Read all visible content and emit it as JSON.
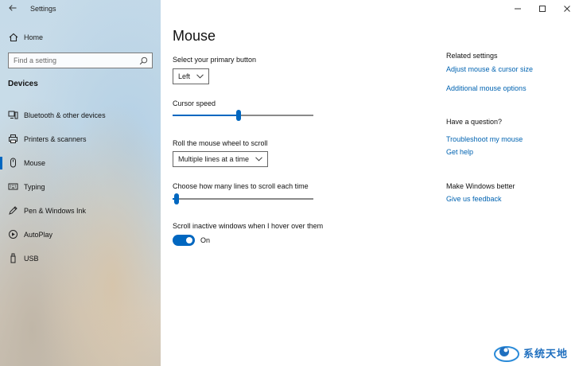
{
  "window": {
    "title": "Settings"
  },
  "sidebar": {
    "home_label": "Home",
    "search_placeholder": "Find a setting",
    "group_label": "Devices",
    "items": [
      {
        "label": "Bluetooth & other devices",
        "icon": "bluetooth-devices-icon"
      },
      {
        "label": "Printers & scanners",
        "icon": "printer-icon"
      },
      {
        "label": "Mouse",
        "icon": "mouse-icon",
        "selected": true
      },
      {
        "label": "Typing",
        "icon": "keyboard-icon"
      },
      {
        "label": "Pen & Windows Ink",
        "icon": "pen-icon"
      },
      {
        "label": "AutoPlay",
        "icon": "autoplay-icon"
      },
      {
        "label": "USB",
        "icon": "usb-icon"
      }
    ]
  },
  "main": {
    "title": "Mouse",
    "primary_button": {
      "label": "Select your primary button",
      "value": "Left"
    },
    "cursor_speed": {
      "label": "Cursor speed",
      "value_fraction": 0.47
    },
    "scroll_mode": {
      "label": "Roll the mouse wheel to scroll",
      "value": "Multiple lines at a time"
    },
    "scroll_lines": {
      "label": "Choose how many lines to scroll each time",
      "value_fraction": 0.03
    },
    "inactive_scroll": {
      "label": "Scroll inactive windows when I hover over them",
      "state": "On"
    }
  },
  "related": {
    "heading": "Related settings",
    "links": [
      "Adjust mouse & cursor size",
      "Additional mouse options"
    ]
  },
  "question": {
    "heading": "Have a question?",
    "links": [
      "Troubleshoot my mouse",
      "Get help"
    ]
  },
  "feedback": {
    "heading": "Make Windows better",
    "link": "Give us feedback"
  },
  "watermark": {
    "text": "系统天地"
  },
  "colors": {
    "accent": "#0067c0",
    "link": "#0063b1"
  }
}
